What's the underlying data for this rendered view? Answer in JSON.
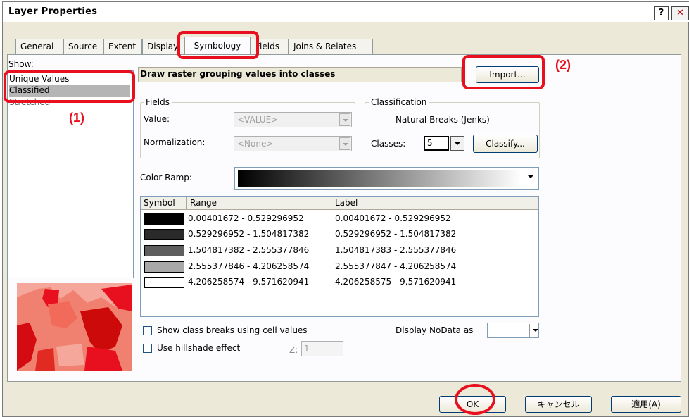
{
  "window": {
    "title": "Layer Properties",
    "help_glyph": "?",
    "close_glyph": "✕"
  },
  "tabs": [
    {
      "label": "General"
    },
    {
      "label": "Source"
    },
    {
      "label": "Extent"
    },
    {
      "label": "Display"
    },
    {
      "label": "Symbology",
      "active": true
    },
    {
      "label": "Fields"
    },
    {
      "label": "Joins & Relates"
    }
  ],
  "show": {
    "label": "Show:",
    "items": [
      "Unique Values",
      "Classified",
      "Stretched"
    ],
    "selected": "Classified"
  },
  "header": {
    "description": "Draw raster grouping values into classes",
    "import_label": "Import..."
  },
  "fields": {
    "group_label": "Fields",
    "value_label": "Value:",
    "value_selected": "<VALUE>",
    "normalization_label": "Normalization:",
    "normalization_selected": "<None>"
  },
  "classification": {
    "group_label": "Classification",
    "method": "Natural Breaks (Jenks)",
    "classes_label": "Classes:",
    "classes_value": "5",
    "classify_label": "Classify..."
  },
  "color_ramp": {
    "label": "Color Ramp:",
    "from_color": "#000000",
    "to_color": "#ffffff"
  },
  "table": {
    "headers": [
      "Symbol",
      "Range",
      "Label"
    ],
    "rows": [
      {
        "color": "#000000",
        "range": "0.00401672 - 0.529296952",
        "label": "0.00401672 - 0.529296952"
      },
      {
        "color": "#2a2a2a",
        "range": "0.529296952 - 1.504817382",
        "label": "0.529296952 - 1.504817382"
      },
      {
        "color": "#5e5e5e",
        "range": "1.504817382 - 2.555377846",
        "label": "1.504817383 - 2.555377846"
      },
      {
        "color": "#a8a8a8",
        "range": "2.555377846 - 4.206258574",
        "label": "2.555377847 - 4.206258574"
      },
      {
        "color": "#ffffff",
        "range": "4.206258574 - 9.571620941",
        "label": "4.206258575 - 9.571620941"
      }
    ]
  },
  "options": {
    "show_breaks_label": "Show class breaks using cell values",
    "display_nodata_label": "Display NoData as",
    "hillshade_label": "Use hillshade effect",
    "z_label": "Z:",
    "z_value": "1"
  },
  "footer": {
    "ok_label": "OK",
    "cancel_label": "キャンセル",
    "apply_label": "適用(A)"
  },
  "annotations": {
    "one": "(1)",
    "two": "(2)",
    "color": "#e8101e"
  }
}
